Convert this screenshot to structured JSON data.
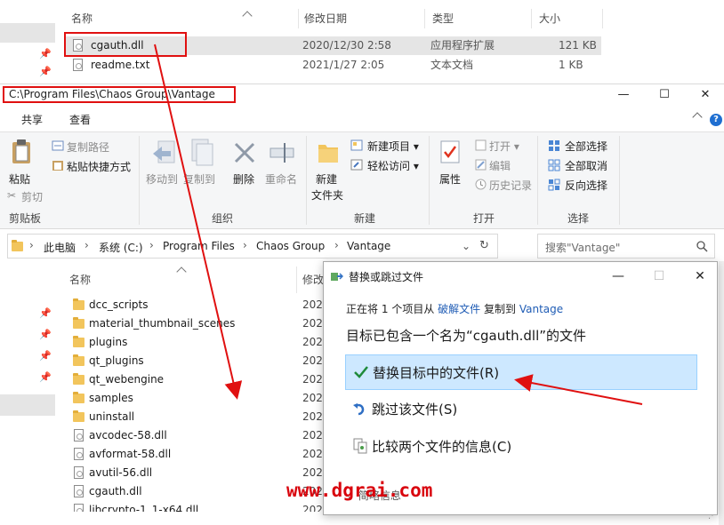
{
  "top_window": {
    "columns": {
      "name": "名称",
      "date": "修改日期",
      "type": "类型",
      "size": "大小"
    },
    "rows": [
      {
        "name": "cgauth.dll",
        "date": "2020/12/30 2:58",
        "type": "应用程序扩展",
        "size": "121 KB",
        "selected": true
      },
      {
        "name": "readme.txt",
        "date": "2021/1/27 2:05",
        "type": "文本文档",
        "size": "1 KB",
        "selected": false
      }
    ]
  },
  "window": {
    "title_path": "C:\\Program Files\\Chaos Group\\Vantage",
    "tabs": [
      "共享",
      "查看"
    ]
  },
  "ribbon": {
    "clipboard": {
      "paste": "粘贴",
      "copy_path": "复制路径",
      "paste_shortcut": "粘贴快捷方式",
      "cut": "剪切",
      "group": "剪贴板"
    },
    "organize": {
      "move_to": "移动到",
      "copy_to": "复制到",
      "delete": "删除",
      "rename": "重命名",
      "group": "组织"
    },
    "new": {
      "new_item": "新建项目",
      "easy_access": "轻松访问",
      "new_folder_1": "新建",
      "new_folder_2": "文件夹",
      "group": "新建"
    },
    "open": {
      "properties": "属性",
      "open": "打开",
      "edit": "编辑",
      "history": "历史记录",
      "group": "打开"
    },
    "select": {
      "select_all": "全部选择",
      "select_none": "全部取消",
      "invert": "反向选择",
      "group": "选择"
    }
  },
  "address": {
    "crumbs": [
      "此电脑",
      "系统 (C:)",
      "Program Files",
      "Chaos Group",
      "Vantage"
    ],
    "search_placeholder": "搜索\"Vantage\""
  },
  "list": {
    "columns": {
      "name": "名称",
      "date": "修改"
    },
    "files": [
      {
        "name": "dcc_scripts",
        "kind": "folder",
        "date": "202"
      },
      {
        "name": "material_thumbnail_scenes",
        "kind": "folder",
        "date": "202"
      },
      {
        "name": "plugins",
        "kind": "folder",
        "date": "202"
      },
      {
        "name": "qt_plugins",
        "kind": "folder",
        "date": "202"
      },
      {
        "name": "qt_webengine",
        "kind": "folder",
        "date": "202"
      },
      {
        "name": "samples",
        "kind": "folder",
        "date": "202"
      },
      {
        "name": "uninstall",
        "kind": "folder",
        "date": "202"
      },
      {
        "name": "avcodec-58.dll",
        "kind": "file",
        "date": "202"
      },
      {
        "name": "avformat-58.dll",
        "kind": "file",
        "date": "202"
      },
      {
        "name": "avutil-56.dll",
        "kind": "file",
        "date": "202"
      },
      {
        "name": "cgauth.dll",
        "kind": "file",
        "date": "202"
      },
      {
        "name": "libcrypto-1_1-x64.dll",
        "kind": "file",
        "date": "202"
      }
    ]
  },
  "dialog": {
    "title": "替换或跳过文件",
    "info_prefix": "正在将",
    "info_count": "1",
    "info_mid": "个项目从",
    "info_source": "破解文件",
    "info_copy": "复制到",
    "info_dest": "Vantage",
    "heading": "目标已包含一个名为“cgauth.dll”的文件",
    "options": {
      "replace": "替换目标中的文件(R)",
      "skip": "跳过该文件(S)",
      "compare": "比较两个文件的信息(C)"
    },
    "details": "简略信息"
  },
  "watermark": "www.dgrai.com",
  "colors": {
    "annotation_red": "#e01010",
    "highlight": "#cde8ff",
    "link": "#1f5cb5",
    "watermark": "#d9050e"
  }
}
